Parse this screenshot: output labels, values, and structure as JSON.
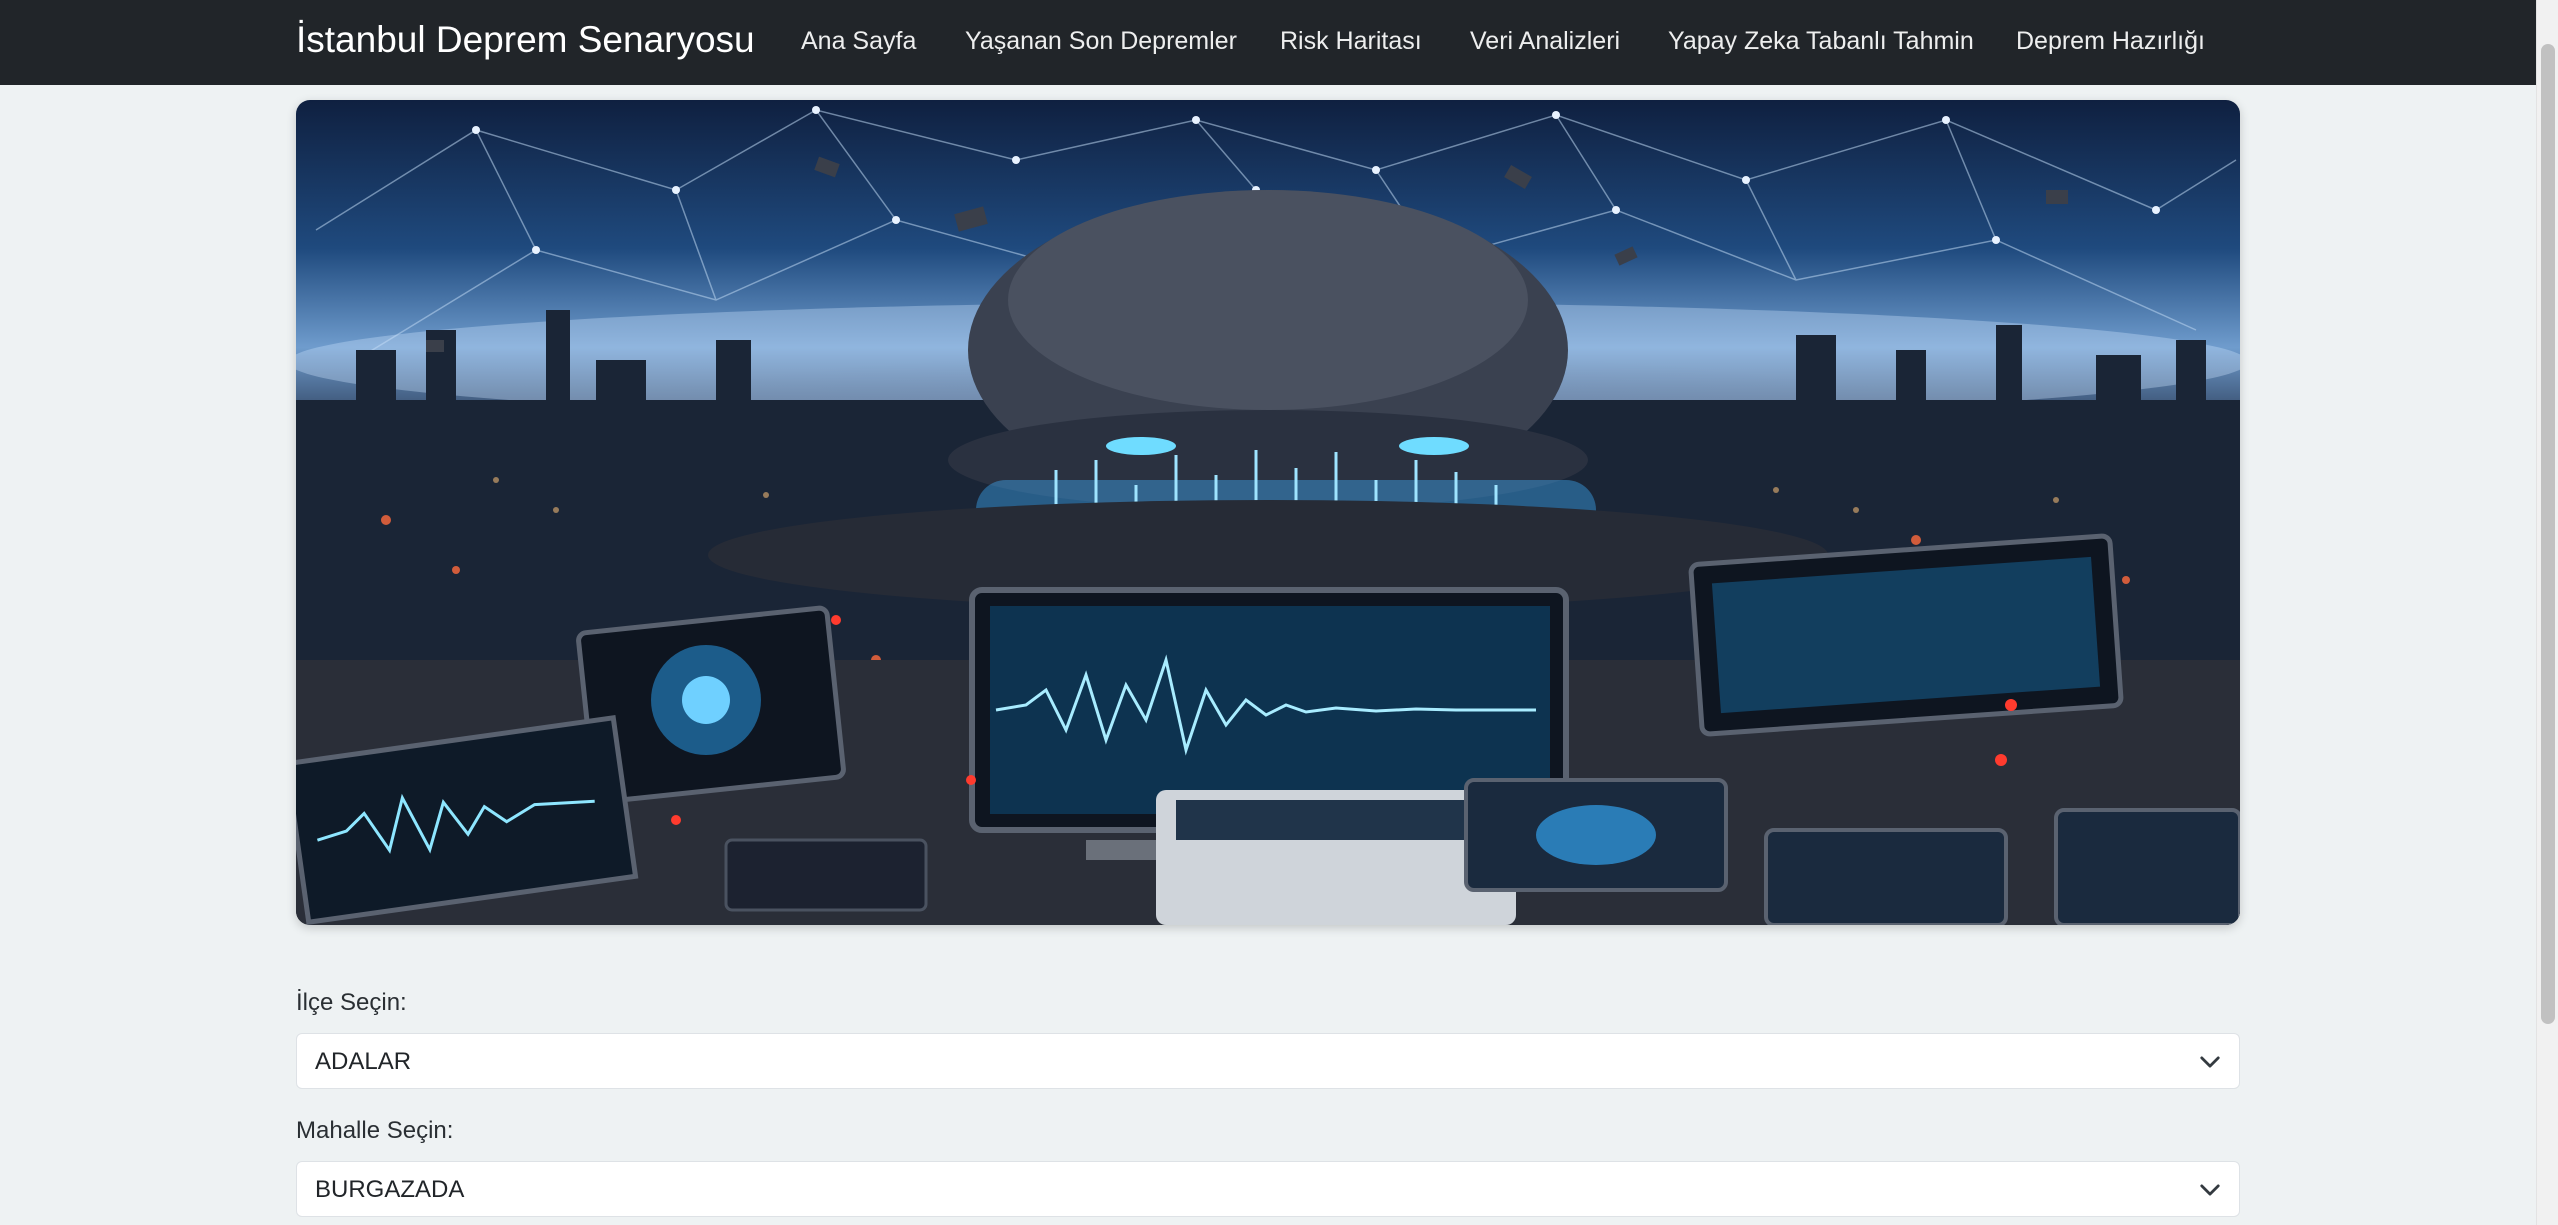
{
  "navbar": {
    "brand": "İstanbul Deprem Senaryosu",
    "links": [
      "Ana Sayfa",
      "Yaşanan Son Depremler",
      "Risk Haritası",
      "Veri Analizleri",
      "Yapay Zeka Tabanlı Tahmin",
      "Deprem Hazırlığı"
    ]
  },
  "form": {
    "district_label": "İlçe Seçin:",
    "district_value": "ADALAR",
    "neighborhood_label": "Mahalle Seçin:",
    "neighborhood_value": "BURGAZADA"
  },
  "colors": {
    "navbar_bg": "#212529",
    "page_bg": "#eef2f3",
    "accent_glow": "#4fc3ff"
  }
}
